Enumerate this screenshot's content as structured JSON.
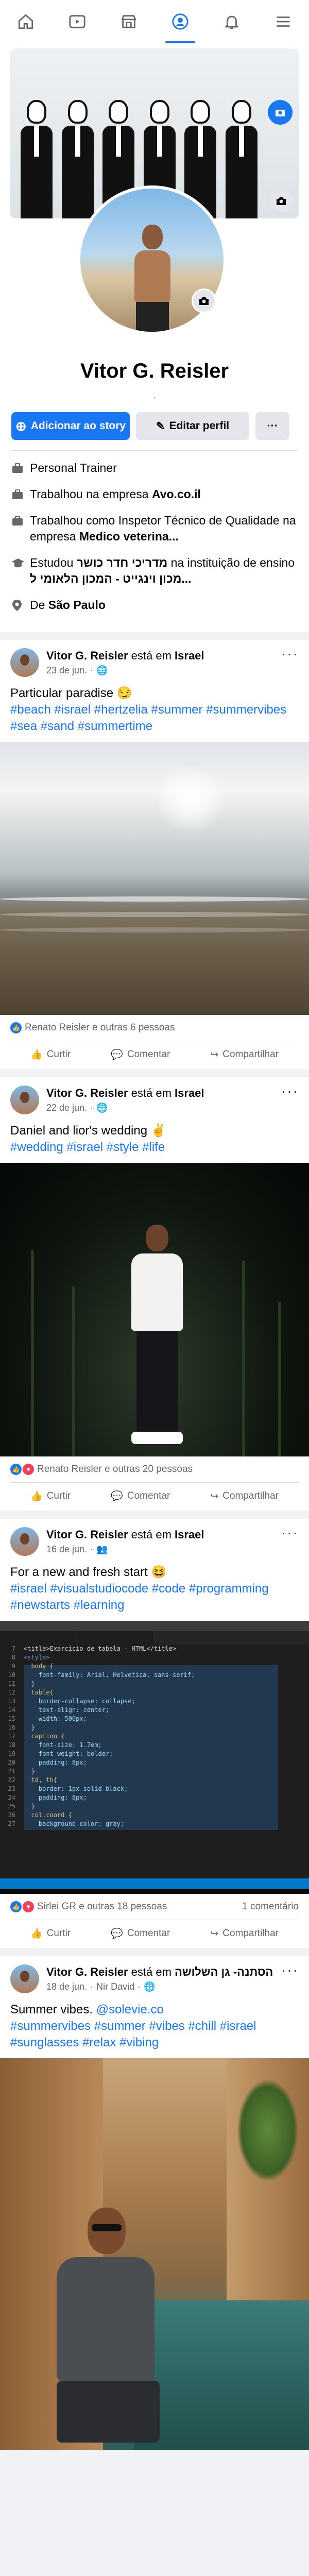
{
  "nav": {
    "items": [
      {
        "icon": "home-icon",
        "active": false
      },
      {
        "icon": "video-icon",
        "active": false
      },
      {
        "icon": "marketplace-icon",
        "active": false
      },
      {
        "icon": "profile-icon",
        "active": true
      },
      {
        "icon": "bell-icon",
        "active": false
      },
      {
        "icon": "menu-icon",
        "active": false
      }
    ],
    "accent": "#1877f2"
  },
  "profile": {
    "name": "Vitor G. Reisler",
    "separator": "·",
    "add_story_label": "Adicionar ao story",
    "edit_profile_label": "Editar perfil",
    "more_label": "···",
    "intro": {
      "job": "Personal Trainer",
      "work1_prefix": "Trabalhou na empresa ",
      "work1_company": "Avo.co.il",
      "work2_prefix": "Trabalhou como Inspetor Técnico de Qualidade na empresa ",
      "work2_company": "Medico veterina...",
      "study_prefix": "Estudou ",
      "study_school": "מדריכי חדר כושר",
      "study_mid": " na instituição de ensino ",
      "study_institution": "מכון וינגייט - המכון הלאומי ל...",
      "from_prefix": "De ",
      "from_city": "São Paulo"
    }
  },
  "posts": [
    {
      "author": "Vitor G. Reisler",
      "at": " está em ",
      "place": "Israel",
      "date": "23 de jun.",
      "audience_icon": "globe-icon",
      "text": "Particular paradise 😏",
      "tags": "#beach #israel #hertzelia #summer #summervibes #sea #sand #summertime",
      "reactions": "Renato Reisler e outras 6 pessoas",
      "comments": "",
      "like": "Curtir",
      "comment": "Comentar",
      "share": "Compartilhar"
    },
    {
      "author": "Vitor G. Reisler",
      "at": " está em ",
      "place": "Israel",
      "date": "22 de jun.",
      "audience_icon": "globe-icon",
      "text": "Daniel and lior's wedding ✌️",
      "tags": "#wedding #israel #style #life",
      "reactions": "Renato Reisler e outras 20 pessoas",
      "comments": "",
      "like": "Curtir",
      "comment": "Comentar",
      "share": "Compartilhar"
    },
    {
      "author": "Vitor G. Reisler",
      "at": " está em ",
      "place": "Israel",
      "date": "16 de jun.",
      "audience_icon": "friends-icon",
      "text": "For a new and fresh start 😆",
      "tags": "#israel #visualstudiocode #code #programming #newstarts #learning",
      "reactions": "Sirlei GR e outras 18 pessoas",
      "comments": "1 comentário",
      "like": "Curtir",
      "comment": "Comentar",
      "share": "Compartilhar",
      "code_lines": [
        "<title>Exercício de tabela - HTML</title>",
        "<style>",
        "  body {",
        "    font-family: Arial, Helvetica, sans-serif;",
        "  }",
        "  table{",
        "    border-collapse: collapse;",
        "    text-align: center;",
        "    width: 500px;",
        "  }",
        "  caption {",
        "    font-size: 1.7em;",
        "    font-weight: bolder;",
        "    padding: 8px;",
        "  }",
        "  td, th{",
        "    border: 1px solid black;",
        "    padding: 8px;",
        "  }",
        "  col.coord {",
        "    background-color: gray;"
      ]
    },
    {
      "author": "Vitor G. Reisler",
      "at": " está em ",
      "place": "הסתנה- גן השלושה",
      "date": "18 de jun.",
      "with": "Nir David",
      "audience_icon": "globe-icon",
      "text": "Summer vibes. ",
      "mention": "@solevie.co",
      "tags": "#summervibes #summer #vibes #chill #israel #sunglasses #relax #vibing",
      "like": "Curtir",
      "comment": "Comentar",
      "share": "Compartilhar"
    }
  ]
}
